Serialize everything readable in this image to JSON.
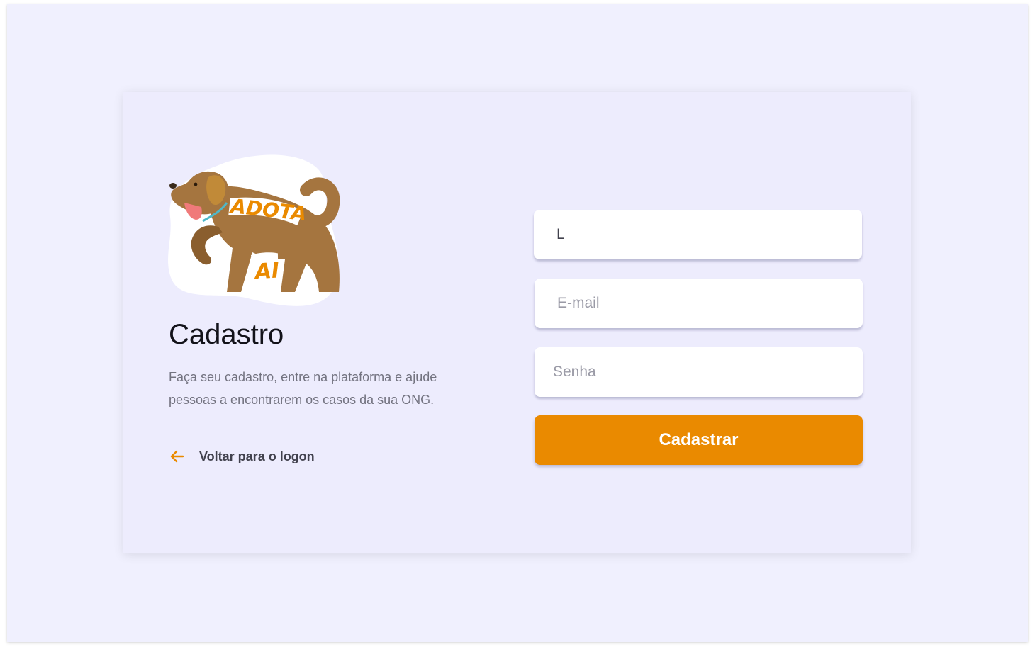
{
  "app": {
    "logo_alt": "Adota Aí",
    "logo_word_top": "ADOTA",
    "logo_word_bottom": "AI"
  },
  "intro": {
    "title": "Cadastro",
    "description": "Faça seu cadastro, entre na plataforma e ajude pessoas a encontrarem os casos da sua ONG.",
    "back_link_label": "Voltar para o logon",
    "back_icon": "arrow-left-icon"
  },
  "form": {
    "name_value": "L",
    "name_placeholder": "",
    "email_placeholder": "E-mail",
    "password_placeholder": "Senha",
    "submit_label": "Cadastrar"
  },
  "colors": {
    "accent": "#EA8A00",
    "background": "#F0F0FE",
    "card": "#EDECFD",
    "title": "#13131A",
    "text": "#737380",
    "dog": "#A5753F"
  }
}
